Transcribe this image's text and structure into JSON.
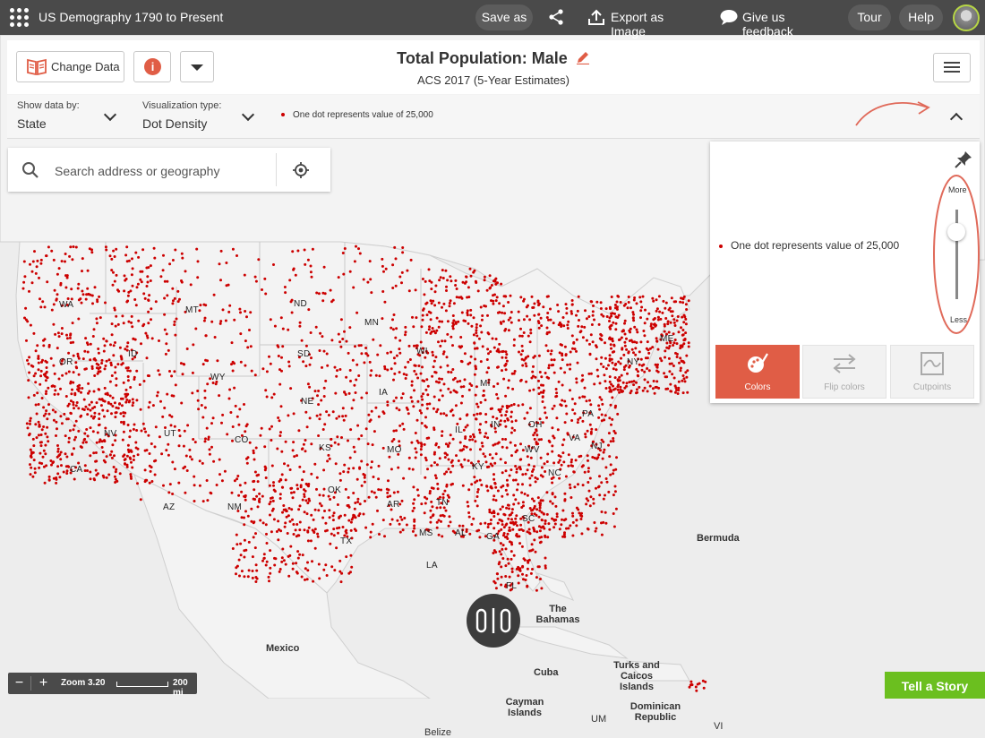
{
  "app": {
    "title": "US Demography 1790 to Present",
    "save_as": "Save as",
    "export": "Export as Image",
    "feedback": "Give us feedback",
    "tour": "Tour",
    "help": "Help"
  },
  "header": {
    "change_data": "Change Data",
    "info": "i",
    "title": "Total Population: Male",
    "subtitle": "ACS 2017 (5-Year Estimates)"
  },
  "options": {
    "show_by_label": "Show data by:",
    "show_by_value": "State",
    "viz_label": "Visualization type:",
    "viz_value": "Dot Density",
    "legend_text": "One dot represents value of 25,000"
  },
  "search": {
    "placeholder": "Search address or geography"
  },
  "legend_panel": {
    "item": "One dot represents value of 25,000",
    "more": "More",
    "less": "Less",
    "tabs": [
      "Colors",
      "Flip colors",
      "Cutpoints"
    ],
    "density_level": 0.8
  },
  "map": {
    "dot_color": "#cc0000",
    "state_labels": [
      "WA",
      "MT",
      "ND",
      "OR",
      "ID",
      "SD",
      "MN",
      "WY",
      "WI",
      "ME",
      "NE",
      "IA",
      "NV",
      "UT",
      "CO",
      "KS",
      "MO",
      "IL",
      "IN",
      "OH",
      "PA",
      "NY",
      "CA",
      "KY",
      "WV",
      "AZ",
      "NM",
      "OK",
      "AR",
      "TN",
      "NC",
      "VA",
      "SC",
      "MS",
      "AL",
      "GA",
      "TX",
      "LA",
      "FL",
      "NJ",
      "MI"
    ],
    "place_labels": [
      "Bermuda",
      "The Bahamas",
      "Mexico",
      "Cuba",
      "Turks and Caicos Islands",
      "Cayman Islands",
      "Dominican Republic",
      "UM",
      "Belize",
      "VI"
    ]
  },
  "footer": {
    "zoom": "Zoom 3.20",
    "scale": "200 mi",
    "tell_story": "Tell a Story"
  }
}
